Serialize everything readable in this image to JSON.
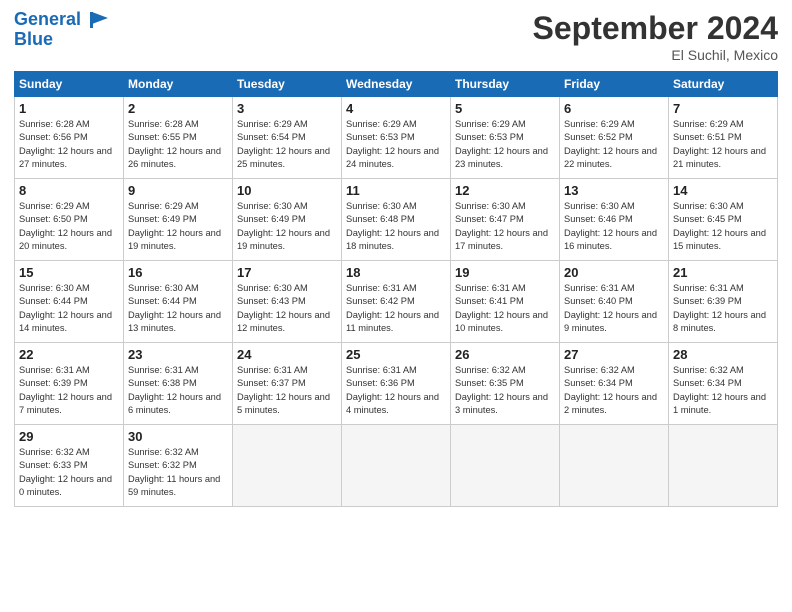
{
  "header": {
    "logo_line1": "General",
    "logo_line2": "Blue",
    "month": "September 2024",
    "location": "El Suchil, Mexico"
  },
  "days_of_week": [
    "Sunday",
    "Monday",
    "Tuesday",
    "Wednesday",
    "Thursday",
    "Friday",
    "Saturday"
  ],
  "weeks": [
    [
      {
        "day": "1",
        "rise": "6:28 AM",
        "set": "6:56 PM",
        "daylight": "12 hours and 27 minutes."
      },
      {
        "day": "2",
        "rise": "6:28 AM",
        "set": "6:55 PM",
        "daylight": "12 hours and 26 minutes."
      },
      {
        "day": "3",
        "rise": "6:29 AM",
        "set": "6:54 PM",
        "daylight": "12 hours and 25 minutes."
      },
      {
        "day": "4",
        "rise": "6:29 AM",
        "set": "6:53 PM",
        "daylight": "12 hours and 24 minutes."
      },
      {
        "day": "5",
        "rise": "6:29 AM",
        "set": "6:53 PM",
        "daylight": "12 hours and 23 minutes."
      },
      {
        "day": "6",
        "rise": "6:29 AM",
        "set": "6:52 PM",
        "daylight": "12 hours and 22 minutes."
      },
      {
        "day": "7",
        "rise": "6:29 AM",
        "set": "6:51 PM",
        "daylight": "12 hours and 21 minutes."
      }
    ],
    [
      {
        "day": "8",
        "rise": "6:29 AM",
        "set": "6:50 PM",
        "daylight": "12 hours and 20 minutes."
      },
      {
        "day": "9",
        "rise": "6:29 AM",
        "set": "6:49 PM",
        "daylight": "12 hours and 19 minutes."
      },
      {
        "day": "10",
        "rise": "6:30 AM",
        "set": "6:49 PM",
        "daylight": "12 hours and 19 minutes."
      },
      {
        "day": "11",
        "rise": "6:30 AM",
        "set": "6:48 PM",
        "daylight": "12 hours and 18 minutes."
      },
      {
        "day": "12",
        "rise": "6:30 AM",
        "set": "6:47 PM",
        "daylight": "12 hours and 17 minutes."
      },
      {
        "day": "13",
        "rise": "6:30 AM",
        "set": "6:46 PM",
        "daylight": "12 hours and 16 minutes."
      },
      {
        "day": "14",
        "rise": "6:30 AM",
        "set": "6:45 PM",
        "daylight": "12 hours and 15 minutes."
      }
    ],
    [
      {
        "day": "15",
        "rise": "6:30 AM",
        "set": "6:44 PM",
        "daylight": "12 hours and 14 minutes."
      },
      {
        "day": "16",
        "rise": "6:30 AM",
        "set": "6:44 PM",
        "daylight": "12 hours and 13 minutes."
      },
      {
        "day": "17",
        "rise": "6:30 AM",
        "set": "6:43 PM",
        "daylight": "12 hours and 12 minutes."
      },
      {
        "day": "18",
        "rise": "6:31 AM",
        "set": "6:42 PM",
        "daylight": "12 hours and 11 minutes."
      },
      {
        "day": "19",
        "rise": "6:31 AM",
        "set": "6:41 PM",
        "daylight": "12 hours and 10 minutes."
      },
      {
        "day": "20",
        "rise": "6:31 AM",
        "set": "6:40 PM",
        "daylight": "12 hours and 9 minutes."
      },
      {
        "day": "21",
        "rise": "6:31 AM",
        "set": "6:39 PM",
        "daylight": "12 hours and 8 minutes."
      }
    ],
    [
      {
        "day": "22",
        "rise": "6:31 AM",
        "set": "6:39 PM",
        "daylight": "12 hours and 7 minutes."
      },
      {
        "day": "23",
        "rise": "6:31 AM",
        "set": "6:38 PM",
        "daylight": "12 hours and 6 minutes."
      },
      {
        "day": "24",
        "rise": "6:31 AM",
        "set": "6:37 PM",
        "daylight": "12 hours and 5 minutes."
      },
      {
        "day": "25",
        "rise": "6:31 AM",
        "set": "6:36 PM",
        "daylight": "12 hours and 4 minutes."
      },
      {
        "day": "26",
        "rise": "6:32 AM",
        "set": "6:35 PM",
        "daylight": "12 hours and 3 minutes."
      },
      {
        "day": "27",
        "rise": "6:32 AM",
        "set": "6:34 PM",
        "daylight": "12 hours and 2 minutes."
      },
      {
        "day": "28",
        "rise": "6:32 AM",
        "set": "6:34 PM",
        "daylight": "12 hours and 1 minute."
      }
    ],
    [
      {
        "day": "29",
        "rise": "6:32 AM",
        "set": "6:33 PM",
        "daylight": "12 hours and 0 minutes."
      },
      {
        "day": "30",
        "rise": "6:32 AM",
        "set": "6:32 PM",
        "daylight": "11 hours and 59 minutes."
      },
      null,
      null,
      null,
      null,
      null
    ]
  ]
}
